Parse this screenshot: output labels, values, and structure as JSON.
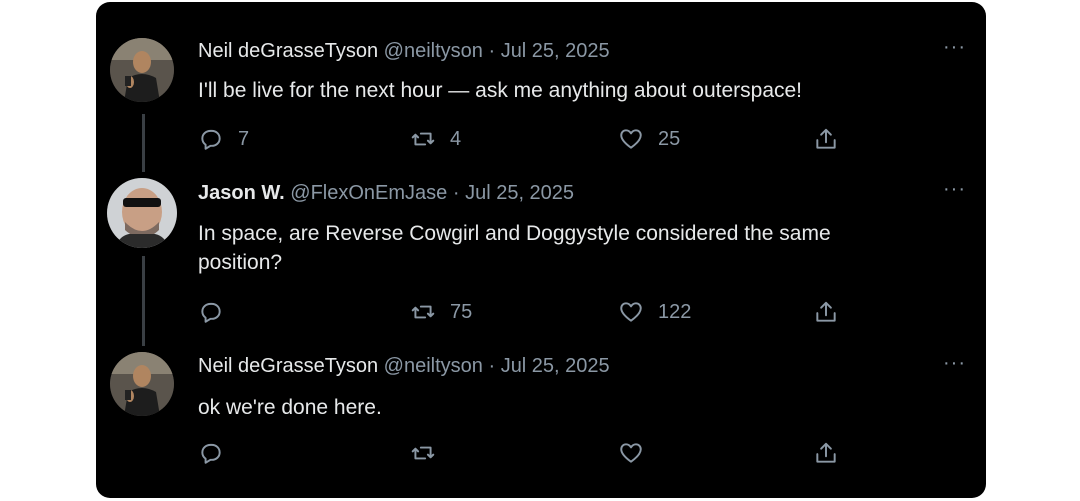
{
  "tweets": [
    {
      "name": "Neil deGrasseTyson",
      "handle": "@neiltyson",
      "date": "Jul 25, 2025",
      "text": "I'll be live for the next hour — ask me anything about outerspace!",
      "reply_count": "7",
      "retweet_count": "4",
      "like_count": "25"
    },
    {
      "name": "Jason W.",
      "handle": "@FlexOnEmJase",
      "date": "Jul 25, 2025",
      "text": "In space, are Reverse Cowgirl and Doggystyle considered the same position?",
      "reply_count": "",
      "retweet_count": "75",
      "like_count": "122"
    },
    {
      "name": "Neil deGrasseTyson",
      "handle": "@neiltyson",
      "date": "Jul 25, 2025",
      "text": "ok we're done here.",
      "reply_count": "",
      "retweet_count": "",
      "like_count": ""
    }
  ],
  "separator": "·",
  "more_label": "···",
  "icons": {
    "reply": "reply-icon",
    "retweet": "retweet-icon",
    "like": "heart-icon",
    "share": "share-icon",
    "more": "more-options-icon"
  },
  "colors": {
    "background": "#000000",
    "text": "#e7e9ea",
    "secondary": "#8b98a5",
    "thread_line": "#3a3f44"
  }
}
